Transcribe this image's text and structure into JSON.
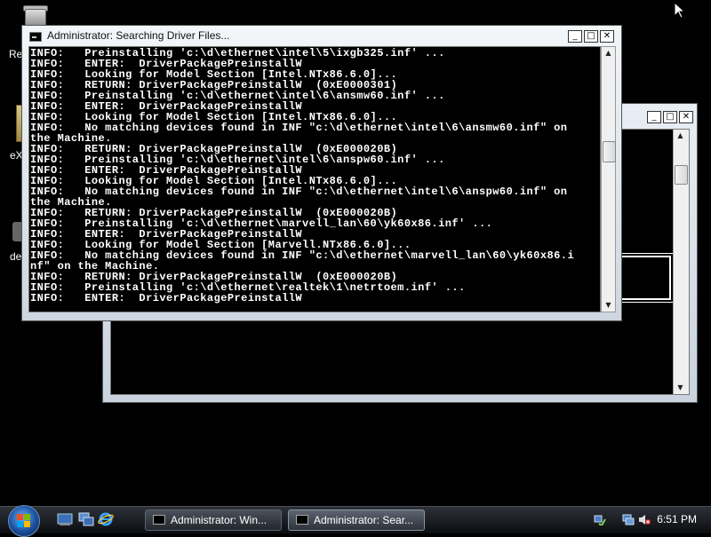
{
  "desktop": {
    "icons": [
      {
        "label": "Re"
      },
      {
        "label": "eX"
      },
      {
        "label": "de"
      }
    ]
  },
  "background_window": {
    "minimize": "_",
    "maximize": "□",
    "close": "✕"
  },
  "console_window": {
    "title": "Administrator:  Searching Driver Files...",
    "minimize": "_",
    "maximize": "□",
    "close": "✕",
    "lines": [
      "INFO:   Preinstalling 'c:\\d\\ethernet\\intel\\5\\ixgb325.inf' ...",
      "INFO:   ENTER:  DriverPackagePreinstallW",
      "INFO:   Looking for Model Section [Intel.NTx86.6.0]...",
      "INFO:   RETURN: DriverPackagePreinstallW  (0xE0000301)",
      "INFO:   Preinstalling 'c:\\d\\ethernet\\intel\\6\\ansmw60.inf' ...",
      "INFO:   ENTER:  DriverPackagePreinstallW",
      "INFO:   Looking for Model Section [Intel.NTx86.6.0]...",
      "INFO:   No matching devices found in INF \"c:\\d\\ethernet\\intel\\6\\ansmw60.inf\" on",
      "the Machine.",
      "INFO:   RETURN: DriverPackagePreinstallW  (0xE000020B)",
      "INFO:   Preinstalling 'c:\\d\\ethernet\\intel\\6\\anspw60.inf' ...",
      "INFO:   ENTER:  DriverPackagePreinstallW",
      "INFO:   Looking for Model Section [Intel.NTx86.6.0]...",
      "INFO:   No matching devices found in INF \"c:\\d\\ethernet\\intel\\6\\anspw60.inf\" on",
      "the Machine.",
      "INFO:   RETURN: DriverPackagePreinstallW  (0xE000020B)",
      "INFO:   Preinstalling 'c:\\d\\ethernet\\marvell_lan\\60\\yk60x86.inf' ...",
      "INFO:   ENTER:  DriverPackagePreinstallW",
      "INFO:   Looking for Model Section [Marvell.NTx86.6.0]...",
      "INFO:   No matching devices found in INF \"c:\\d\\ethernet\\marvell_lan\\60\\yk60x86.i",
      "nf\" on the Machine.",
      "INFO:   RETURN: DriverPackagePreinstallW  (0xE000020B)",
      "INFO:   Preinstalling 'c:\\d\\ethernet\\realtek\\1\\netrtoem.inf' ...",
      "INFO:   ENTER:  DriverPackagePreinstallW"
    ]
  },
  "taskbar": {
    "start_icon": "windows-orb-icon",
    "quick_launch": [
      "show-desktop-icon",
      "switch-windows-icon",
      "internet-explorer-icon"
    ],
    "tasks": [
      {
        "label": "Administrator:  Win...",
        "active": false
      },
      {
        "label": "Administrator:  Sear...",
        "active": true
      }
    ],
    "tray_icons": [
      "network-icon",
      "volume-muted-icon"
    ],
    "clock": "6:51 PM"
  }
}
